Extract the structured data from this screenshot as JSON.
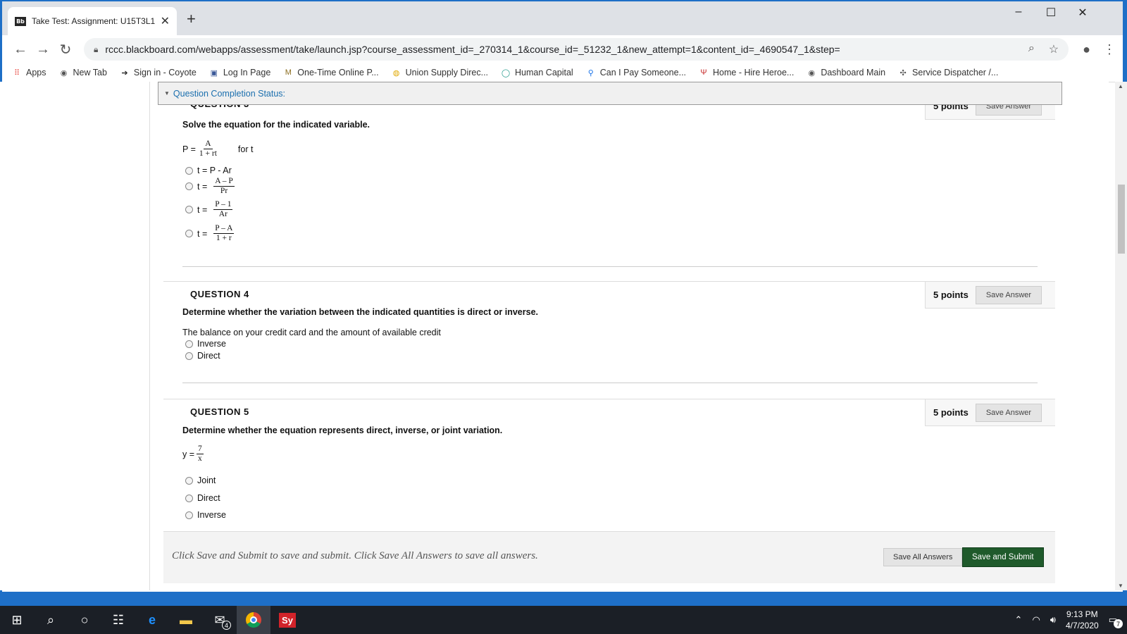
{
  "browser": {
    "tab_title": "Take Test: Assignment: U15T3L1 -",
    "favicon_text": "Bb",
    "url": "rccc.blackboard.com/webapps/assessment/take/launch.jsp?course_assessment_id=_270314_1&course_id=_51232_1&new_attempt=1&content_id=_4690547_1&step=",
    "bookmarks": [
      {
        "label": "Apps",
        "icon": "apps-grid-icon"
      },
      {
        "label": "New Tab",
        "icon": "globe-icon"
      },
      {
        "label": "Sign in - Coyote",
        "icon": "arrow-icon"
      },
      {
        "label": "Log In Page",
        "icon": "tc-icon"
      },
      {
        "label": "One-Time Online P...",
        "icon": "m-icon"
      },
      {
        "label": "Union Supply Direc...",
        "icon": "union-icon"
      },
      {
        "label": "Human Capital",
        "icon": "circle-icon"
      },
      {
        "label": "Can I Pay Someone...",
        "icon": "pin-icon"
      },
      {
        "label": "Home - Hire Heroe...",
        "icon": "hh-icon"
      },
      {
        "label": "Dashboard Main",
        "icon": "globe-icon"
      },
      {
        "label": "Service Dispatcher /...",
        "icon": "dispatcher-icon"
      }
    ]
  },
  "page": {
    "status_label": "Question Completion Status:",
    "questions": [
      {
        "title": "QUESTION 3",
        "points": "5 points",
        "save_label": "Save Answer",
        "prompt": "Solve the equation for the indicated variable.",
        "equation": {
          "lhs": "P =",
          "num": "A",
          "den": "1 + rt",
          "suffix": "for t"
        },
        "options": [
          {
            "prefix": "t = P - Ar"
          },
          {
            "prefix": "t =",
            "num": "A – P",
            "den": "Pr"
          },
          {
            "prefix": "t =",
            "num": "P – 1",
            "den": "Ar"
          },
          {
            "prefix": "t =",
            "num": "P – A",
            "den": "1 + r"
          }
        ]
      },
      {
        "title": "QUESTION 4",
        "points": "5 points",
        "save_label": "Save Answer",
        "prompt": "Determine whether the variation between the indicated quantities is direct or inverse.",
        "text": "The balance on your credit card and the amount of available credit",
        "options": [
          "Inverse",
          "Direct"
        ]
      },
      {
        "title": "QUESTION 5",
        "points": "5 points",
        "save_label": "Save Answer",
        "prompt": "Determine whether the equation represents direct, inverse, or joint variation.",
        "equation": {
          "lhs": "y =",
          "num": "7",
          "den": "x"
        },
        "options": [
          "Joint",
          "Direct",
          "Inverse"
        ]
      }
    ],
    "footer": {
      "instructions": "Click Save and Submit to save and submit. Click Save All Answers to save all answers.",
      "save_all_label": "Save All Answers",
      "submit_label": "Save and Submit"
    }
  },
  "taskbar": {
    "time": "9:13 PM",
    "date": "4/7/2020",
    "mail_badge": "4",
    "notification_count": "7",
    "sy_label": "Sy"
  }
}
